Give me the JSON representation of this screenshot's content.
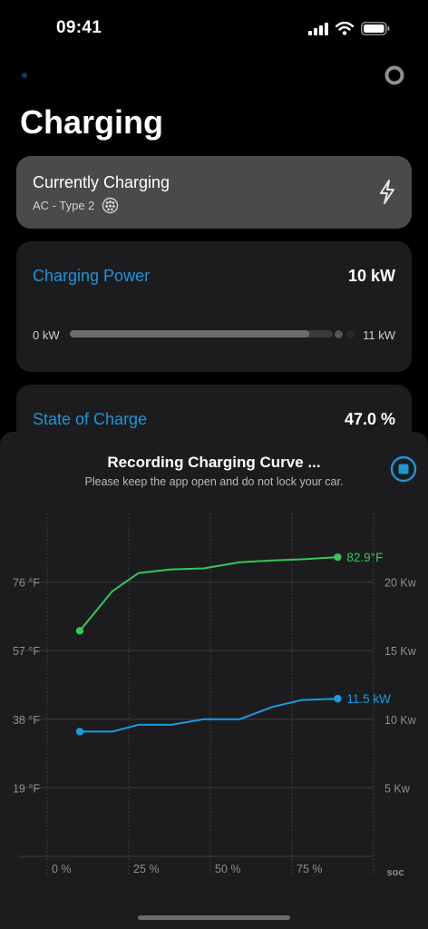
{
  "status_bar": {
    "time": "09:41"
  },
  "page": {
    "title": "Charging"
  },
  "current": {
    "title": "Currently Charging",
    "connector": "AC - Type 2"
  },
  "power": {
    "label": "Charging Power",
    "value": "10 kW",
    "min_label": "0 kW",
    "max_label": "11 kW",
    "fill_fraction": 0.91
  },
  "soc": {
    "label": "State of Charge",
    "value": "47.0 %"
  },
  "sheet": {
    "title": "Recording Charging Curve ...",
    "subtitle": "Please keep the app open and do not lock your car."
  },
  "colors": {
    "accent": "#1e95d6",
    "temperature": "#34c759",
    "power": "#1a9be0"
  },
  "icons": [
    "settings-icon",
    "bolt-icon",
    "type2-connector-icon",
    "stop-icon",
    "signal-icon",
    "wifi-icon",
    "battery-icon"
  ],
  "chart_data": {
    "type": "line",
    "x_ticks": [
      "0 %",
      "25 %",
      "50 %",
      "75 %"
    ],
    "x_tick_values": [
      0,
      25,
      50,
      75
    ],
    "xlabel": "SOC",
    "xlim": [
      0,
      100
    ],
    "y_left_ticks": [
      "19 °F",
      "38 °F",
      "57 °F",
      "76 °F"
    ],
    "y_left_tick_values": [
      19,
      38,
      57,
      76
    ],
    "y_left_lim": [
      0,
      95
    ],
    "y_right_ticks": [
      "5 Kw",
      "10 Kw",
      "15 Kw",
      "20 Kw"
    ],
    "y_right_tick_values": [
      5,
      10,
      15,
      20
    ],
    "y_right_lim": [
      0,
      25
    ],
    "grid": true,
    "series": [
      {
        "axis": "left",
        "end_label": "82.9°F",
        "x": [
          10,
          20,
          28,
          38,
          48,
          59,
          69,
          78,
          89
        ],
        "values": [
          62.5,
          73.5,
          78.5,
          79.5,
          79.8,
          81.5,
          82.0,
          82.3,
          82.9
        ]
      },
      {
        "axis": "right",
        "end_label": "11.5 kW",
        "x": [
          10,
          20,
          28,
          38,
          48,
          59,
          69,
          78,
          89
        ],
        "values": [
          9.1,
          9.1,
          9.6,
          9.6,
          10.0,
          10.0,
          10.9,
          11.4,
          11.5
        ]
      }
    ]
  }
}
